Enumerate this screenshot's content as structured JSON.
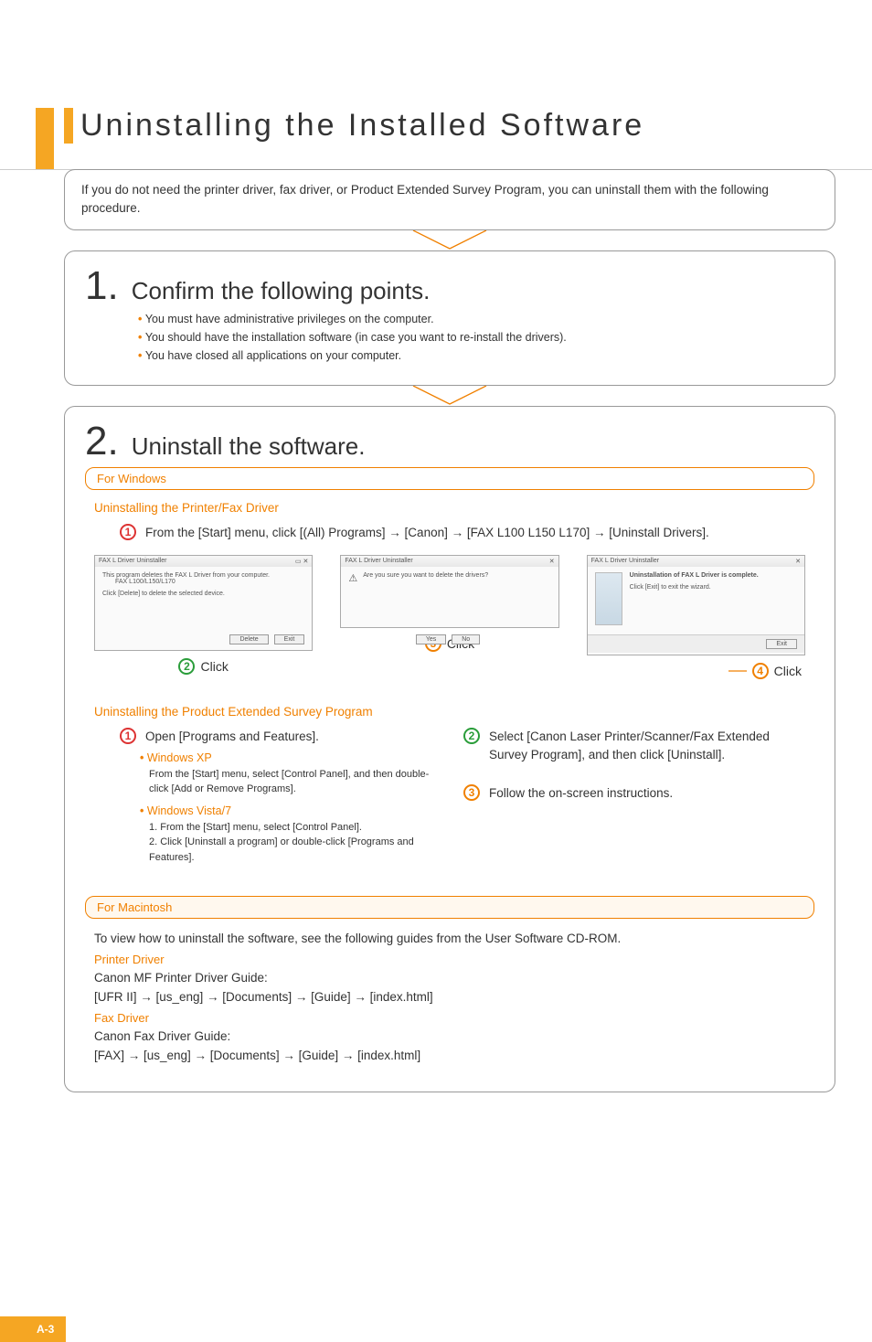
{
  "page_number": "A-3",
  "title": "Uninstalling the Installed Software",
  "intro": "If you do not need the printer driver, fax driver, or Product Extended Survey Program, you can uninstall them with the following procedure.",
  "step1": {
    "num": "1.",
    "title": "Confirm the following points.",
    "bullets": [
      "You must have administrative privileges on the computer.",
      "You should have the installation software (in case you want to re-install the drivers).",
      "You have closed all applications on your computer."
    ]
  },
  "step2": {
    "num": "2.",
    "title": "Uninstall the software.",
    "windows_label": "For Windows",
    "mac_label": "For Macintosh",
    "section_a": {
      "heading": "Uninstalling the Printer/Fax Driver",
      "instr1": "From the [Start] menu, click [(All) Programs] → [Canon] → [FAX L100 L150 L170] → [Uninstall Drivers].",
      "dlg1": {
        "title": "FAX L Driver Uninstaller",
        "line1": "This program deletes the FAX L Driver from your computer.",
        "line2": "FAX L100/L150/L170",
        "line3": "Click [Delete] to delete the selected device.",
        "btn_delete": "Delete",
        "btn_exit": "Exit"
      },
      "dlg2": {
        "title": "FAX L Driver Uninstaller",
        "msg": "Are you sure you want to delete the drivers?",
        "btn_yes": "Yes",
        "btn_no": "No"
      },
      "dlg3": {
        "title": "FAX L Driver Uninstaller",
        "msg1": "Uninstallation of FAX L Driver is complete.",
        "msg2": "Click [Exit] to exit the wizard.",
        "btn_exit": "Exit"
      },
      "click_label": "Click"
    },
    "section_b": {
      "heading": "Uninstalling the Product Extended Survey Program",
      "left": {
        "instr1": "Open [Programs and Features].",
        "xp_hd": "Windows XP",
        "xp_txt": "From the [Start] menu, select [Control Panel], and then double-click [Add or Remove Programs].",
        "vista_hd": "Windows Vista/7",
        "vista_txt1": "1. From the [Start] menu, select [Control Panel].",
        "vista_txt2": "2. Click [Uninstall a program] or double-click [Programs and Features]."
      },
      "right": {
        "instr2": "Select [Canon Laser Printer/Scanner/Fax Extended Survey Program], and then click [Uninstall].",
        "instr3": "Follow the on-screen instructions."
      }
    },
    "mac": {
      "intro": "To view how to uninstall the software, see the following guides from the User Software CD-ROM.",
      "pd_hd": "Printer Driver",
      "pd_l1": "Canon MF Printer Driver Guide:",
      "pd_l2": "[UFR II] → [us_eng] → [Documents] → [Guide] → [index.html]",
      "fd_hd": "Fax Driver",
      "fd_l1": "Canon Fax Driver Guide:",
      "fd_l2": "[FAX] → [us_eng] → [Documents] → [Guide] → [index.html]"
    }
  }
}
